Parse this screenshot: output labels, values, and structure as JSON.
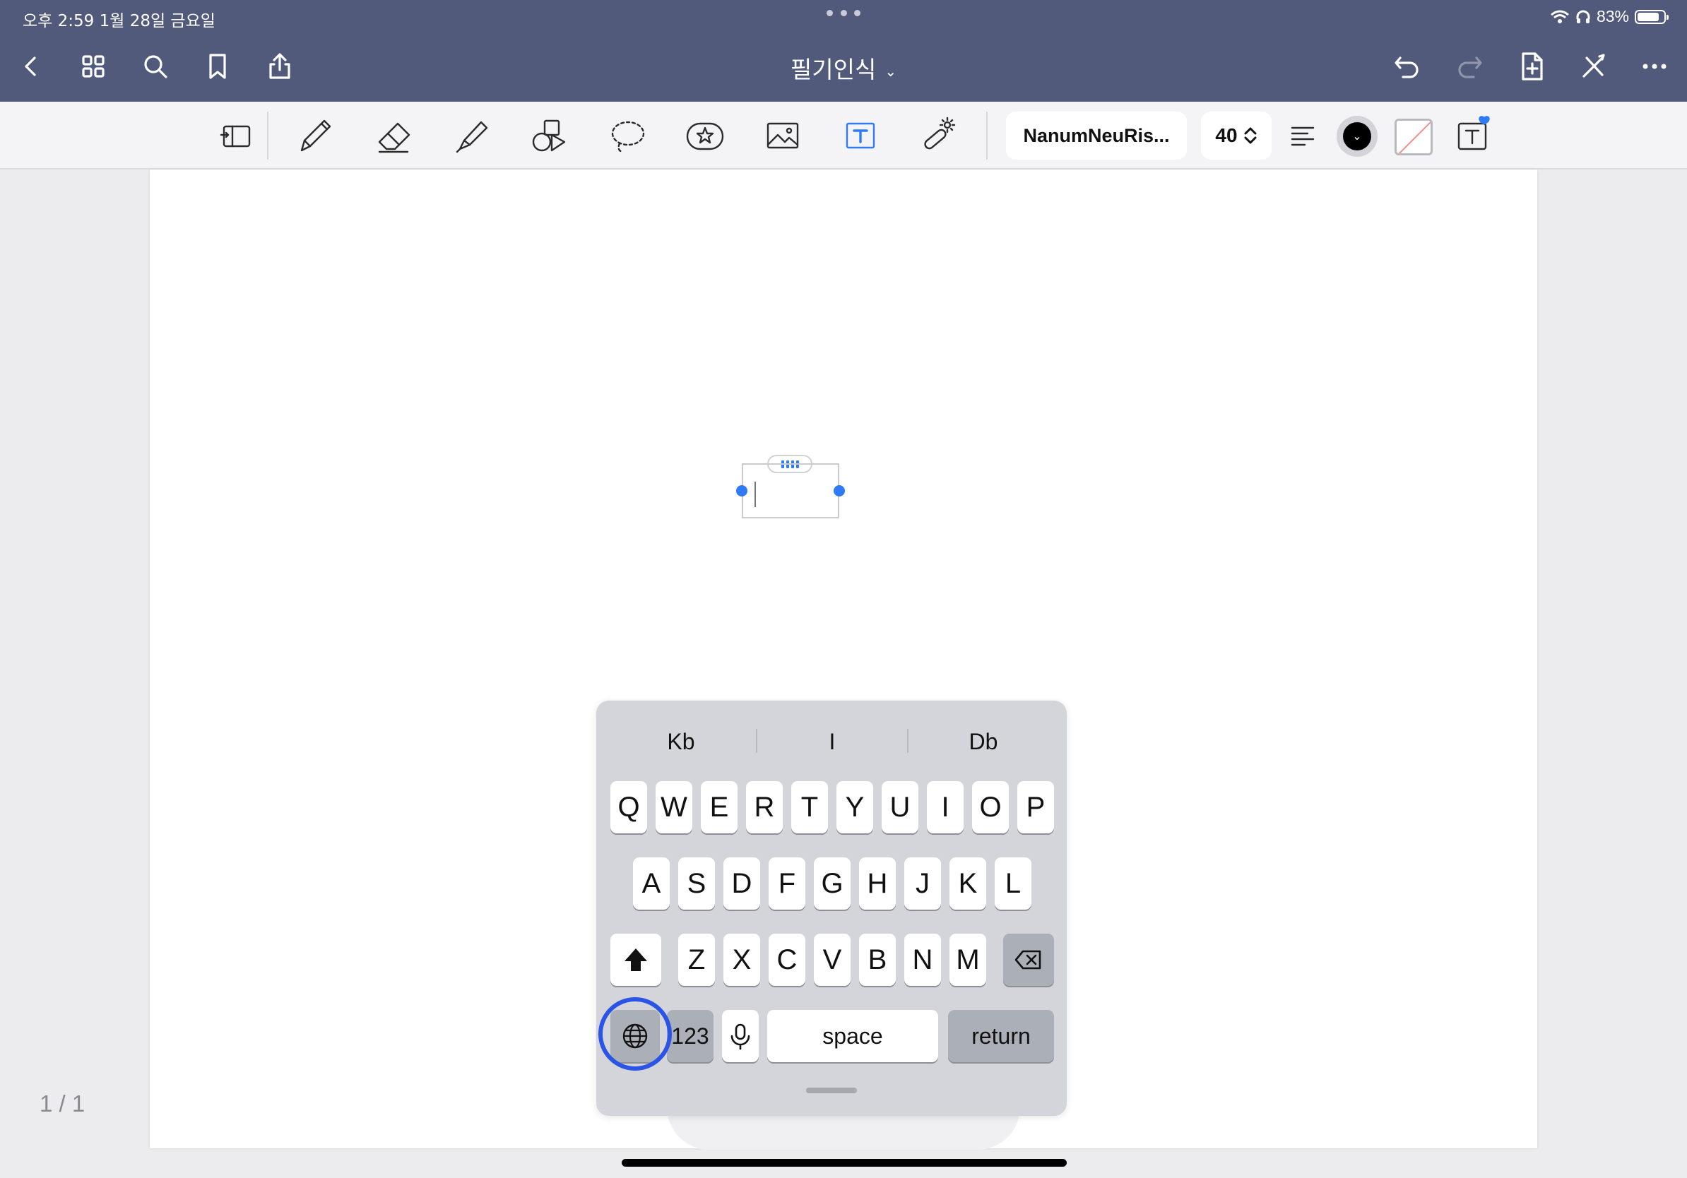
{
  "status_bar": {
    "time": "오후 2:59   1월 28일 금요일",
    "battery": "83%",
    "battery_level": 0.83
  },
  "nav": {
    "title": "필기인식",
    "title_chevron": "⌄",
    "icons": [
      "back-chevron-icon",
      "grid-icon",
      "search-icon",
      "bookmark-icon",
      "share-icon",
      "undo-icon",
      "redo-icon",
      "add-page-icon",
      "close-tools-icon",
      "more-icon"
    ]
  },
  "toolbar": {
    "font_name": "NanumNeuRis...",
    "font_size": "40",
    "text_color": "#000000",
    "active_tool": "text-tool",
    "accent": "#2f7bf5",
    "theme": "#525a7c"
  },
  "page": {
    "counter": "1 / 1"
  },
  "keyboard": {
    "suggestions": [
      "Kb",
      "I",
      "Db"
    ],
    "row1": [
      "Q",
      "W",
      "E",
      "R",
      "T",
      "Y",
      "U",
      "I",
      "O",
      "P"
    ],
    "row2": [
      "A",
      "S",
      "D",
      "F",
      "G",
      "H",
      "J",
      "K",
      "L"
    ],
    "row3": [
      "Z",
      "X",
      "C",
      "V",
      "B",
      "N",
      "M"
    ],
    "numbers": "123",
    "space": "space",
    "return": "return",
    "highlight_color": "#2a54e6"
  }
}
